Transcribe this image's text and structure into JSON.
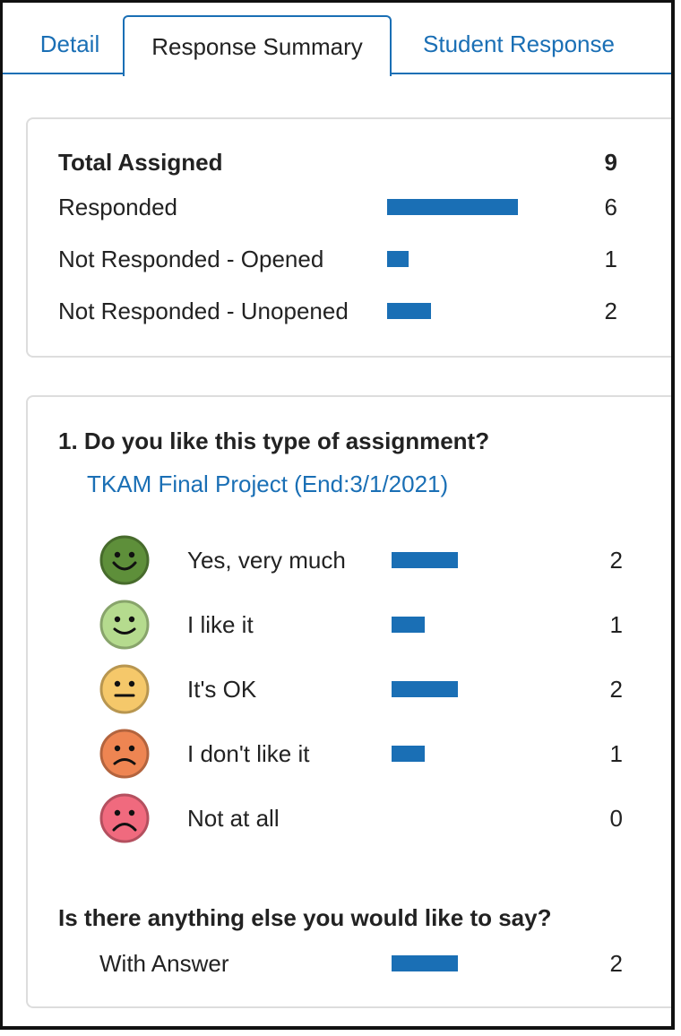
{
  "tabs": [
    {
      "label": "Detail",
      "active": false
    },
    {
      "label": "Response Summary",
      "active": true
    },
    {
      "label": "Student Response",
      "active": false
    }
  ],
  "summary": {
    "total_label": "Total Assigned",
    "total_value": "9",
    "rows": [
      {
        "label": "Responded",
        "value": "6",
        "fraction": 0.667
      },
      {
        "label": "Not Responded - Opened",
        "value": "1",
        "fraction": 0.111
      },
      {
        "label": "Not Responded - Unopened",
        "value": "2",
        "fraction": 0.222
      }
    ]
  },
  "question": {
    "title": "1. Do you like this type of assignment?",
    "assignment_link": "TKAM Final Project (End:3/1/2021)",
    "options": [
      {
        "label": "Yes, very much",
        "value": "2",
        "fraction": 1.0,
        "icon": "very-happy-face-icon",
        "color": "#5e8f3a"
      },
      {
        "label": "I like it",
        "value": "1",
        "fraction": 0.5,
        "icon": "happy-face-icon",
        "color": "#b5db8e"
      },
      {
        "label": "It's OK",
        "value": "2",
        "fraction": 1.0,
        "icon": "neutral-face-icon",
        "color": "#f5c86a"
      },
      {
        "label": "I don't like it",
        "value": "1",
        "fraction": 0.5,
        "icon": "sad-face-icon",
        "color": "#ee8552"
      },
      {
        "label": "Not at all",
        "value": "0",
        "fraction": 0.0,
        "icon": "very-sad-face-icon",
        "color": "#f06a7e"
      }
    ]
  },
  "question2": {
    "title": "Is there anything else you would like to say?",
    "rows": [
      {
        "label": "With Answer",
        "value": "2",
        "fraction": 1.0
      }
    ]
  },
  "colors": {
    "accent": "#1a6fb5",
    "border": "#dddddd"
  }
}
